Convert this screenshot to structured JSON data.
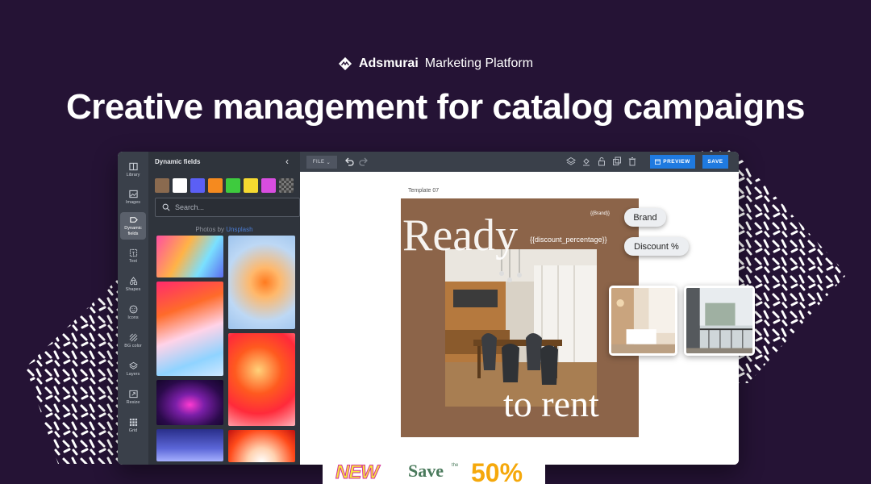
{
  "brand": {
    "name": "Adsmurai",
    "tagline": "Marketing Platform"
  },
  "headline": "Creative management for catalog campaigns",
  "rail": {
    "items": [
      {
        "label": "Library",
        "icon": "library-icon"
      },
      {
        "label": "Images",
        "icon": "image-icon"
      },
      {
        "label": "Dynamic fields",
        "icon": "dynamic-fields-icon",
        "active": true
      },
      {
        "label": "Text",
        "icon": "text-icon"
      },
      {
        "label": "Shapes",
        "icon": "shapes-icon"
      },
      {
        "label": "Icons",
        "icon": "smiley-icon"
      },
      {
        "label": "BG color",
        "icon": "bg-color-icon"
      },
      {
        "label": "Layers",
        "icon": "layers-icon"
      },
      {
        "label": "Resize",
        "icon": "resize-icon"
      },
      {
        "label": "Grid",
        "icon": "grid-icon"
      }
    ]
  },
  "panel": {
    "title": "Dynamic fields",
    "collapse": "‹",
    "swatches": [
      "#8a6a4f",
      "#ffffff",
      "#5b5ff5",
      "#f58a1f",
      "#3ecb3e",
      "#f5d930",
      "#d84de0"
    ],
    "search_placeholder": "Search...",
    "photos_by": "Photos by",
    "photos_source": "Unsplash"
  },
  "toolbar": {
    "file_label": "FILE",
    "preview_label": "PREVIEW",
    "save_label": "SAVE"
  },
  "canvas": {
    "template_name": "Template 07",
    "headline_top": "Ready",
    "headline_bottom": "to rent",
    "brand_field": "{{Brand}}",
    "discount_field": "{{discount_percentage}}"
  },
  "chips": {
    "brand": "Brand",
    "discount": "Discount %"
  },
  "bottom_card": {
    "new": "NEW",
    "save": "Save",
    "the": "the",
    "percent": "50%"
  }
}
